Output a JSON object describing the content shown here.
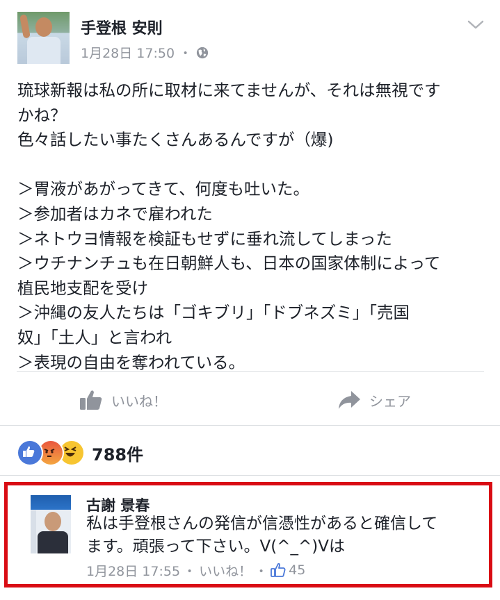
{
  "post": {
    "author": "手登根 安則",
    "timestamp": "1月28日 17:50",
    "meta_separator": "・",
    "privacy_icon": "globe-icon",
    "menu_icon": "chevron-down-icon",
    "body_lines": [
      "琉球新報は私の所に取材に来てませんが、それは無視です",
      "かね？",
      "色々話したい事たくさんあるんですが（爆)",
      "",
      "＞胃液があがってきて、何度も吐いた。",
      "＞参加者はカネで雇われた",
      "＞ネトウヨ情報を検証もせずに垂れ流してしまった",
      "＞ウチナンチュも在日朝鮮人も、日本の国家体制によって",
      "植民地支配を受け",
      "＞沖縄の友人たちは「ゴキブリ」「ドブネズミ」「売国",
      "奴」「土人」と言われ",
      "＞表現の自由を奪われている。"
    ]
  },
  "actions": {
    "like_label": "いいね！",
    "share_label": "シェア",
    "like_icon": "thumbs-up-icon",
    "share_icon": "share-arrow-icon"
  },
  "reactions": {
    "count": "788件",
    "icons": [
      "like-reaction-icon",
      "angry-reaction-icon",
      "haha-reaction-icon"
    ]
  },
  "comment": {
    "author": "古謝 景春",
    "text_lines": [
      "私は手登根さんの発信が信憑性があると確信して",
      "ます。頑張って下さい。V(^_^)Vは"
    ],
    "timestamp": "1月28日 17:55",
    "separator": "・",
    "like_link": "いいね！",
    "like_count": "45"
  },
  "colors": {
    "text": "#1d2129",
    "meta": "#90949c",
    "divider": "#dadde1",
    "highlight_border": "#d90c14",
    "like_blue": "#4a78d9"
  }
}
